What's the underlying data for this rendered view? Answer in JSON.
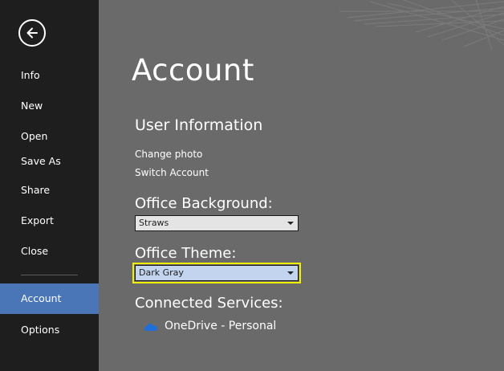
{
  "nav": {
    "items": [
      {
        "label": "Info",
        "active": false
      },
      {
        "label": "New",
        "active": false
      },
      {
        "label": "Open",
        "active": false
      },
      {
        "label": "Save As",
        "active": false
      },
      {
        "label": "Share",
        "active": false
      },
      {
        "label": "Export",
        "active": false
      },
      {
        "label": "Close",
        "active": false
      },
      {
        "label": "Account",
        "active": true
      },
      {
        "label": "Options",
        "active": false
      }
    ]
  },
  "main": {
    "title": "Account",
    "user_info": {
      "heading": "User Information",
      "change_photo": "Change photo",
      "switch_account": "Switch Account"
    },
    "office_background": {
      "label": "Office Background:",
      "selected": "Straws"
    },
    "office_theme": {
      "label": "Office Theme:",
      "selected": "Dark Gray"
    },
    "connected_services": {
      "heading": "Connected Services:",
      "items": [
        {
          "label": "OneDrive - Personal",
          "icon": "onedrive-cloud-icon"
        }
      ]
    }
  },
  "colors": {
    "sidebar_bg": "#1e1e1e",
    "content_bg": "#6a6a6a",
    "accent": "#4a76b8",
    "focus_outline": "#f0f000",
    "onedrive_blue": "#1e6fd9"
  }
}
